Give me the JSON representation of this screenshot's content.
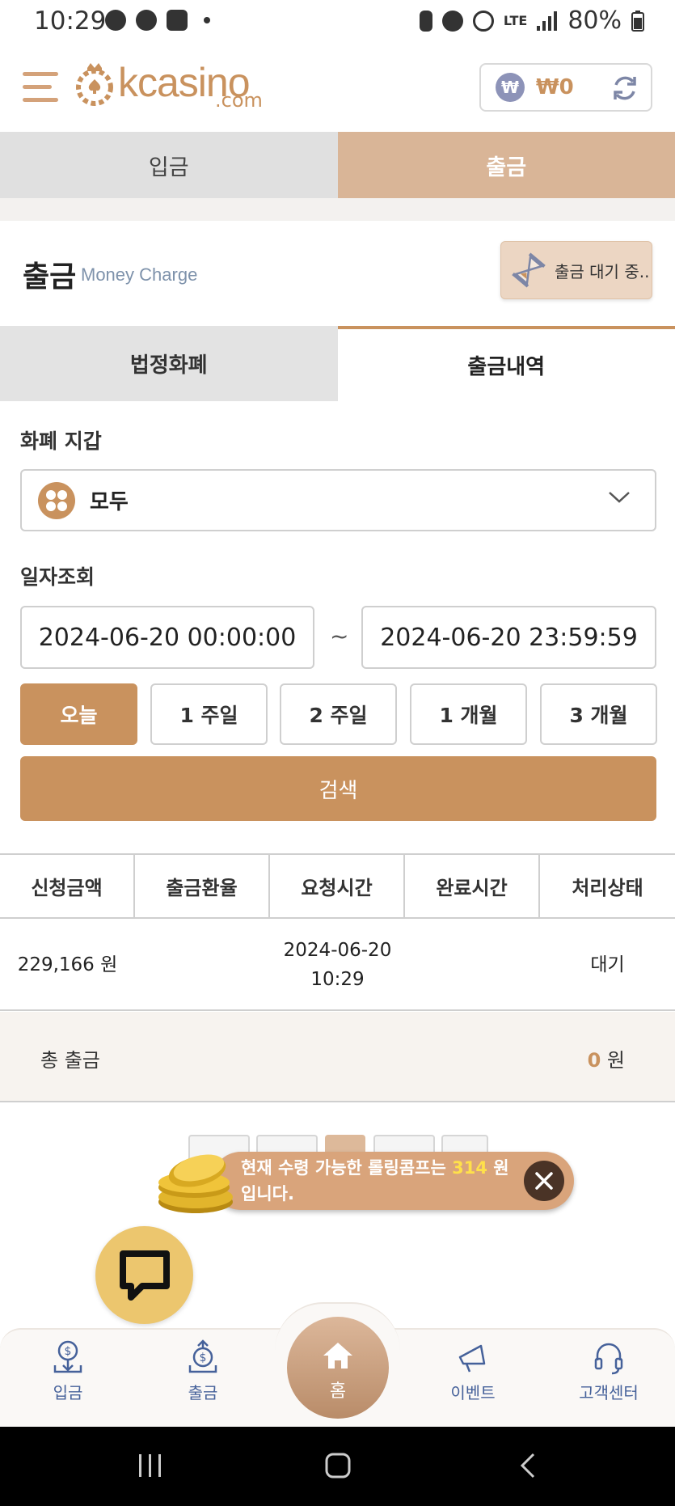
{
  "status_bar": {
    "time": "10:29",
    "battery": "80%",
    "network": "LTE"
  },
  "header": {
    "logo_text": "kcasino",
    "logo_sub": ".com",
    "balance_currency": "₩",
    "balance": "₩0"
  },
  "top_tabs": {
    "deposit": "입금",
    "withdraw": "출금"
  },
  "page": {
    "title": "출금",
    "subtitle": "Money Charge",
    "pending_button": "출금 대기 중.."
  },
  "sub_tabs": {
    "legal_currency": "법정화폐",
    "history": "출금내역"
  },
  "filters": {
    "wallet_label": "화폐 지갑",
    "wallet_value": "모두",
    "date_label": "일자조회",
    "date_from": "2024-06-20 00:00:00",
    "date_sep": "~",
    "date_to": "2024-06-20 23:59:59",
    "ranges": [
      "오늘",
      "1 주일",
      "2 주일",
      "1 개월",
      "3 개월"
    ],
    "search_button": "검색"
  },
  "table": {
    "headers": [
      "신청금액",
      "출금환율",
      "요청시간",
      "완료시간",
      "처리상태"
    ],
    "rows": [
      {
        "amount": "229,166 원",
        "rate": "",
        "request_date": "2024-06-20",
        "request_time": "10:29",
        "complete": "",
        "status": "대기"
      }
    ],
    "total_label": "총 출금",
    "total_value": "0",
    "total_unit": "원"
  },
  "toast": {
    "text_before": "현재 수령 가능한 롤링콤프는 ",
    "amount": "314",
    "text_after": " 원 입니다."
  },
  "bottom_nav": {
    "deposit": "입금",
    "withdraw": "출금",
    "home": "홈",
    "event": "이벤트",
    "support": "고객센터"
  },
  "colors": {
    "accent": "#c9925e",
    "accent_light": "#d9b597",
    "nav_text": "#45619a",
    "highlight": "#ffe14a"
  }
}
